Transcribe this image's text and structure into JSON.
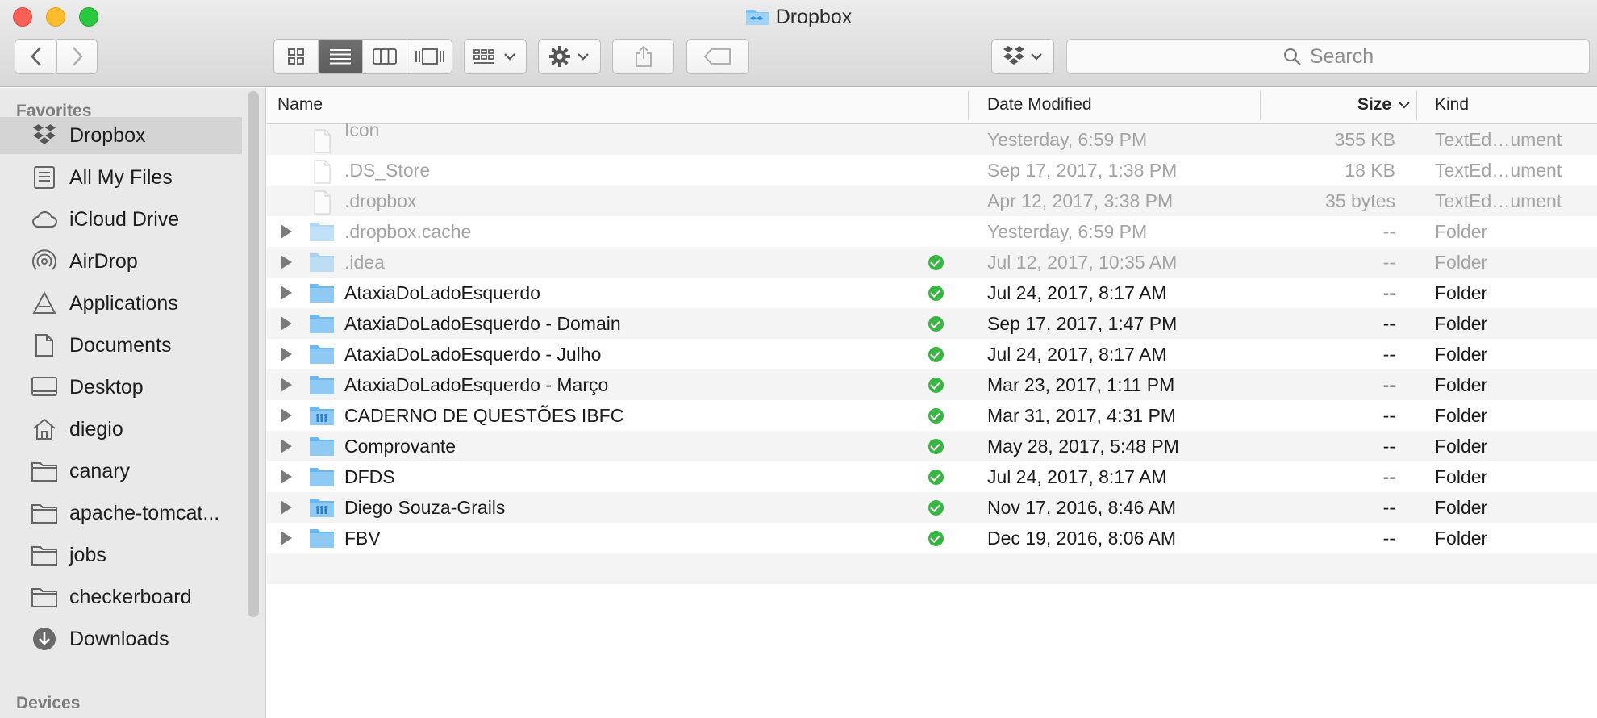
{
  "window": {
    "title": "Dropbox"
  },
  "toolbar": {
    "search_placeholder": "Search"
  },
  "sidebar": {
    "favorites_heading": "Favorites",
    "devices_heading": "Devices",
    "items": [
      {
        "label": "Dropbox",
        "icon": "dropbox-icon",
        "selected": true
      },
      {
        "label": "All My Files",
        "icon": "all-files-icon"
      },
      {
        "label": "iCloud Drive",
        "icon": "cloud-icon"
      },
      {
        "label": "AirDrop",
        "icon": "airdrop-icon"
      },
      {
        "label": "Applications",
        "icon": "applications-icon"
      },
      {
        "label": "Documents",
        "icon": "documents-icon"
      },
      {
        "label": "Desktop",
        "icon": "desktop-icon"
      },
      {
        "label": "diegio",
        "icon": "home-icon"
      },
      {
        "label": "canary",
        "icon": "folder-icon"
      },
      {
        "label": "apache-tomcat...",
        "icon": "folder-icon"
      },
      {
        "label": "jobs",
        "icon": "folder-icon"
      },
      {
        "label": "checkerboard",
        "icon": "folder-icon"
      },
      {
        "label": "Downloads",
        "icon": "downloads-icon"
      }
    ]
  },
  "columns": {
    "name": "Name",
    "date": "Date Modified",
    "size": "Size",
    "kind": "Kind"
  },
  "files": [
    {
      "name": "Icon",
      "date": "Yesterday, 6:59 PM",
      "size": "355 KB",
      "kind": "TextEd…ument",
      "type": "file",
      "dim": true,
      "synced": false
    },
    {
      "name": ".DS_Store",
      "date": "Sep 17, 2017, 1:38 PM",
      "size": "18 KB",
      "kind": "TextEd…ument",
      "type": "file",
      "dim": true,
      "synced": false
    },
    {
      "name": ".dropbox",
      "date": "Apr 12, 2017, 3:38 PM",
      "size": "35 bytes",
      "kind": "TextEd…ument",
      "type": "file",
      "dim": true,
      "synced": false
    },
    {
      "name": ".dropbox.cache",
      "date": "Yesterday, 6:59 PM",
      "size": "--",
      "kind": "Folder",
      "type": "folder",
      "dim": true,
      "synced": false
    },
    {
      "name": ".idea",
      "date": "Jul 12, 2017, 10:35 AM",
      "size": "--",
      "kind": "Folder",
      "type": "folder",
      "dim": true,
      "synced": true
    },
    {
      "name": "AtaxiaDoLadoEsquerdo",
      "date": "Jul 24, 2017, 8:17 AM",
      "size": "--",
      "kind": "Folder",
      "type": "folder",
      "dim": false,
      "synced": true
    },
    {
      "name": "AtaxiaDoLadoEsquerdo - Domain",
      "date": "Sep 17, 2017, 1:47 PM",
      "size": "--",
      "kind": "Folder",
      "type": "folder",
      "dim": false,
      "synced": true
    },
    {
      "name": "AtaxiaDoLadoEsquerdo - Julho",
      "date": "Jul 24, 2017, 8:17 AM",
      "size": "--",
      "kind": "Folder",
      "type": "folder",
      "dim": false,
      "synced": true
    },
    {
      "name": "AtaxiaDoLadoEsquerdo - Março",
      "date": "Mar 23, 2017, 1:11 PM",
      "size": "--",
      "kind": "Folder",
      "type": "folder",
      "dim": false,
      "synced": true
    },
    {
      "name": "CADERNO DE QUESTÕES IBFC",
      "date": "Mar 31, 2017, 4:31 PM",
      "size": "--",
      "kind": "Folder",
      "type": "shared-folder",
      "dim": false,
      "synced": true
    },
    {
      "name": "Comprovante",
      "date": "May 28, 2017, 5:48 PM",
      "size": "--",
      "kind": "Folder",
      "type": "folder",
      "dim": false,
      "synced": true
    },
    {
      "name": "DFDS",
      "date": "Jul 24, 2017, 8:17 AM",
      "size": "--",
      "kind": "Folder",
      "type": "folder",
      "dim": false,
      "synced": true
    },
    {
      "name": "Diego Souza-Grails",
      "date": "Nov 17, 2016, 8:46 AM",
      "size": "--",
      "kind": "Folder",
      "type": "shared-folder",
      "dim": false,
      "synced": true
    },
    {
      "name": "FBV",
      "date": "Dec 19, 2016, 8:06 AM",
      "size": "--",
      "kind": "Folder",
      "type": "folder",
      "dim": false,
      "synced": true
    }
  ],
  "colors": {
    "sync_ok": "#38b542",
    "folder_blue": "#7cc2f2",
    "selected_sidebar": "#d4d4d4"
  }
}
